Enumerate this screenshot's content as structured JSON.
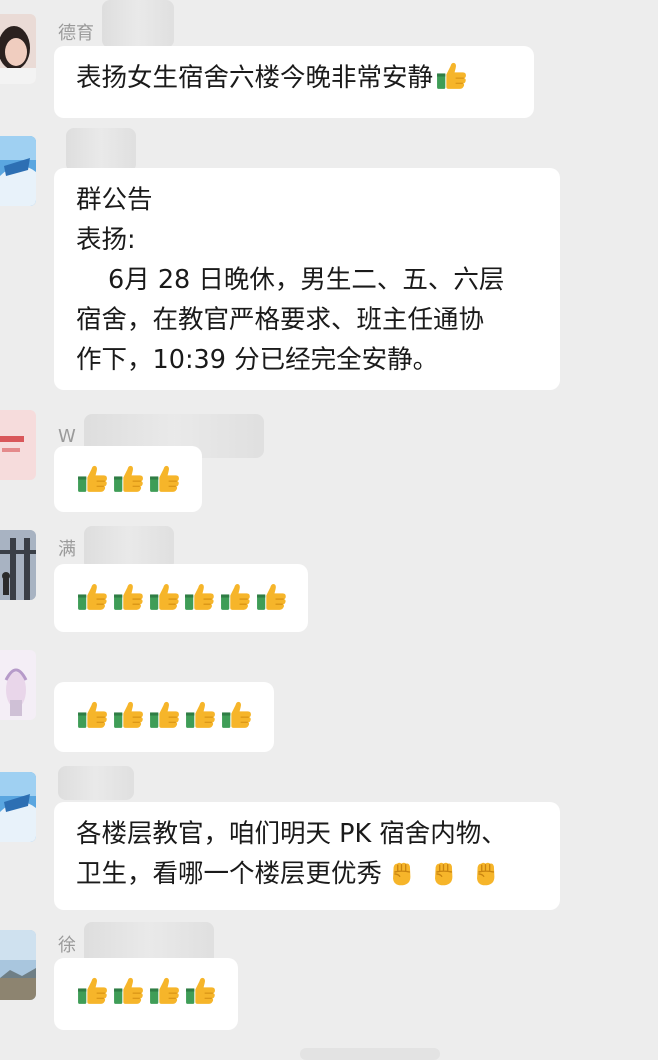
{
  "messages": [
    {
      "sender": "德育",
      "text": "表扬女生宿舍六楼今晚非常安静",
      "trail_emoji": "thumbs-up"
    },
    {
      "sender": "",
      "lines": [
        "群公告",
        "表扬:",
        "6月 28 日晚休，男生二、五、六层",
        "宿舍，在教官严格要求、班主任通协",
        "作下，10:39 分已经完全安静。"
      ]
    },
    {
      "sender": "W",
      "thumbs": 3
    },
    {
      "sender": "满",
      "thumbs": 6
    },
    {
      "sender": "",
      "thumbs": 5
    },
    {
      "sender": "",
      "lines": [
        "各楼层教官，咱们明天 PK 宿舍内物、",
        "卫生，看哪一个楼层更优秀"
      ],
      "trail_emoji": "raised-fist",
      "trail_count": 3
    },
    {
      "sender": "徐",
      "thumbs": 4
    }
  ],
  "colors": {
    "background": "#ededed",
    "bubble": "#ffffff",
    "sender_text": "#9a9a9a",
    "thumb_yellow": "#f6b52a",
    "cuff_green": "#3f9d57"
  }
}
